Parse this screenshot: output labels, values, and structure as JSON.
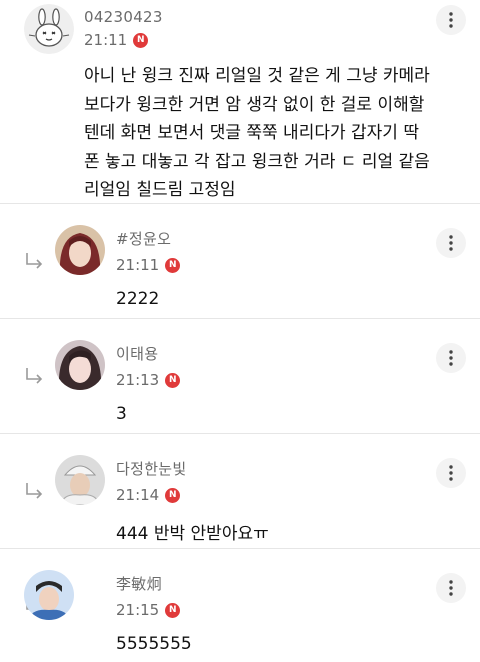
{
  "comments": [
    {
      "author": "04230423",
      "time": "21:11",
      "new_badge": "N",
      "body": "아니 난 윙크 진짜 리얼일 것 같은 게 그냥 카메라\n보다가 윙크한 거면 암 생각 없이 한 걸로 이해할\n텐데 화면 보면서 댓글 쭉쭉 내리다가 갑자기 딱\n폰 놓고 대놓고 각 잡고 윙크한 거라 ㄷ 리얼 같음\n리얼임 칠드림 고정임",
      "avatar_icon": "bunny-avatar-icon"
    },
    {
      "author": "#정윤오",
      "time": "21:11",
      "new_badge": "N",
      "body": "2222",
      "avatar_icon": "profile-photo"
    },
    {
      "author": "이태용",
      "time": "21:13",
      "new_badge": "N",
      "body": "3",
      "avatar_icon": "profile-photo"
    },
    {
      "author": "다정한눈빛",
      "time": "21:14",
      "new_badge": "N",
      "body": "444 반박 안받아요ㅠ",
      "avatar_icon": "profile-photo"
    },
    {
      "author": "李敏炯",
      "time": "21:15",
      "new_badge": "N",
      "body": "5555555",
      "avatar_icon": "profile-photo"
    }
  ],
  "icons": {
    "more": "more-vertical-icon",
    "reply": "reply-arrow-icon"
  },
  "colors": {
    "new_badge": "#e03a3a",
    "meta_text": "#6b6b6b",
    "body_text": "#111111"
  }
}
